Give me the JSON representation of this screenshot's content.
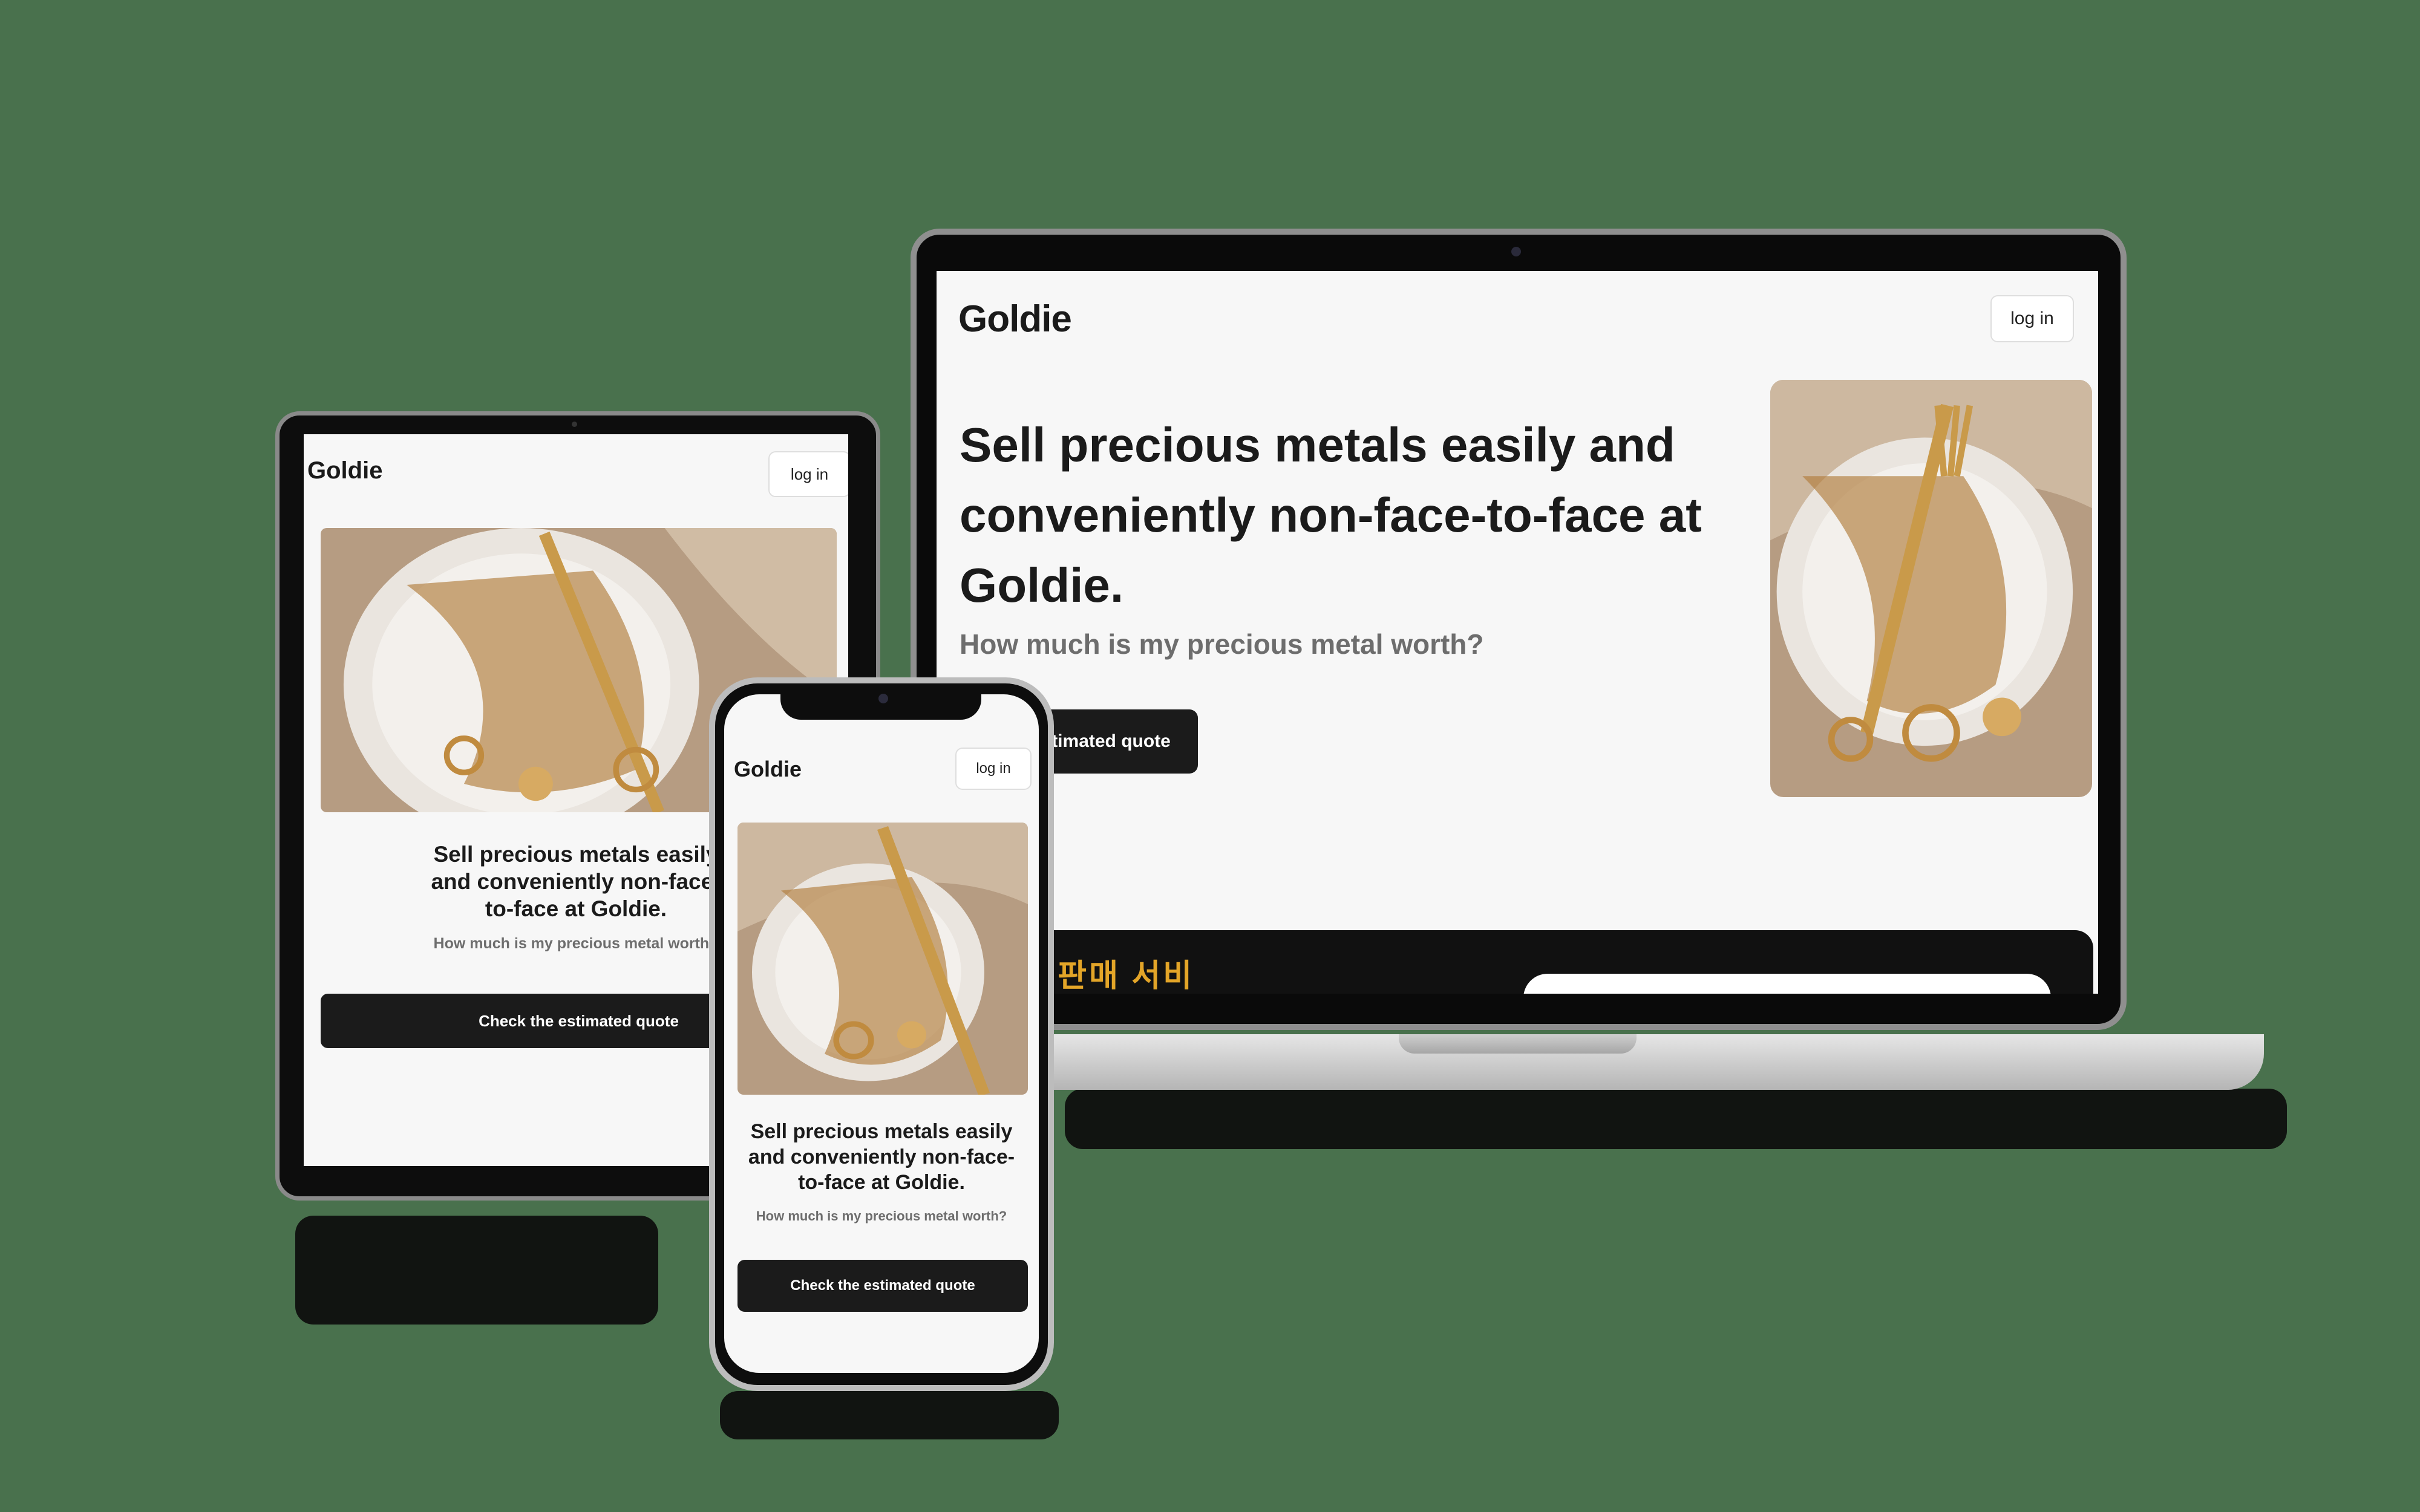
{
  "colors": {
    "background": "#49714d",
    "button_dark": "#1b1b1b",
    "screen": "#f7f7f7",
    "band_accent": "#e3a528"
  },
  "laptop": {
    "logo": "Goldie",
    "login_label": "log in",
    "title": "Sell precious metals easily and conveniently non-face-to-face at Goldie.",
    "subtitle": "How much is my precious metal worth?",
    "cta_label": "Check the estimated quote",
    "band_text": "금 판매 서비"
  },
  "tablet": {
    "logo": "Goldie",
    "login_label": "log in",
    "title": "Sell precious metals easily and conveniently non-face-to-face at Goldie.",
    "subtitle": "How much is my precious metal worth?",
    "cta_label": "Check the estimated quote"
  },
  "phone": {
    "logo": "Goldie",
    "login_label": "log in",
    "title": "Sell precious metals easily and conveniently non-face-to-face at Goldie.",
    "subtitle": "How much is my precious metal worth?",
    "cta_label": "Check the estimated quote"
  },
  "images": {
    "hero_photo": "jewelry-plate-photo-icon"
  }
}
